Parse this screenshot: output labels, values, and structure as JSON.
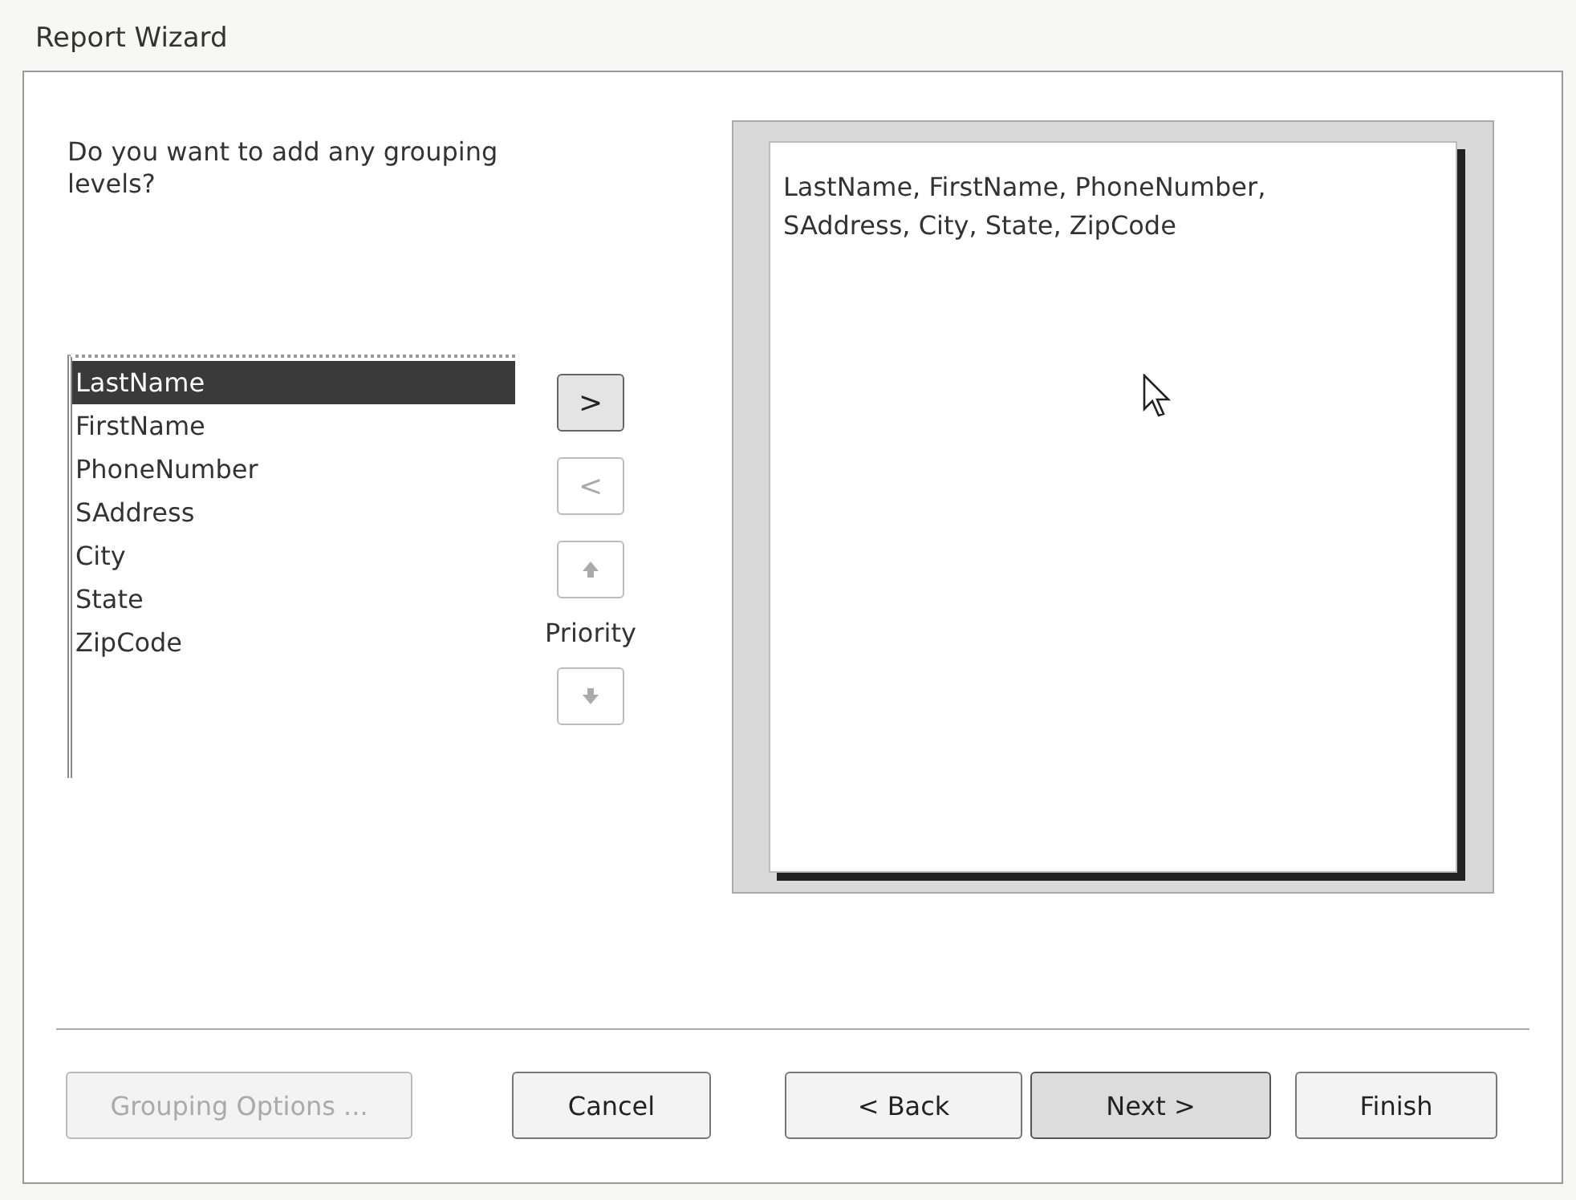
{
  "window": {
    "title": "Report Wizard"
  },
  "question": "Do you want to add any grouping levels?",
  "fields": [
    {
      "label": "LastName",
      "selected": true
    },
    {
      "label": "FirstName",
      "selected": false
    },
    {
      "label": "PhoneNumber",
      "selected": false
    },
    {
      "label": "SAddress",
      "selected": false
    },
    {
      "label": "City",
      "selected": false
    },
    {
      "label": "State",
      "selected": false
    },
    {
      "label": "ZipCode",
      "selected": false
    }
  ],
  "move_buttons": [
    {
      "kind": "add",
      "label": ">",
      "disabled": false
    },
    {
      "kind": "remove",
      "label": "<",
      "disabled": true
    },
    {
      "kind": "up",
      "disabled": true
    },
    {
      "kind": "priority"
    },
    {
      "kind": "down",
      "disabled": true
    }
  ],
  "priority_label": "Priority",
  "preview": {
    "text": "LastName, FirstName, PhoneNumber, SAddress, City, State, ZipCode"
  },
  "buttons": [
    {
      "label": "Grouping Options ...",
      "disabled": true,
      "default": false
    },
    {
      "label": "Cancel",
      "disabled": false,
      "default": false
    },
    {
      "label": "< Back",
      "disabled": false,
      "default": false
    },
    {
      "label": "Next >",
      "disabled": false,
      "default": true
    },
    {
      "label": "Finish",
      "disabled": false,
      "default": false
    }
  ]
}
